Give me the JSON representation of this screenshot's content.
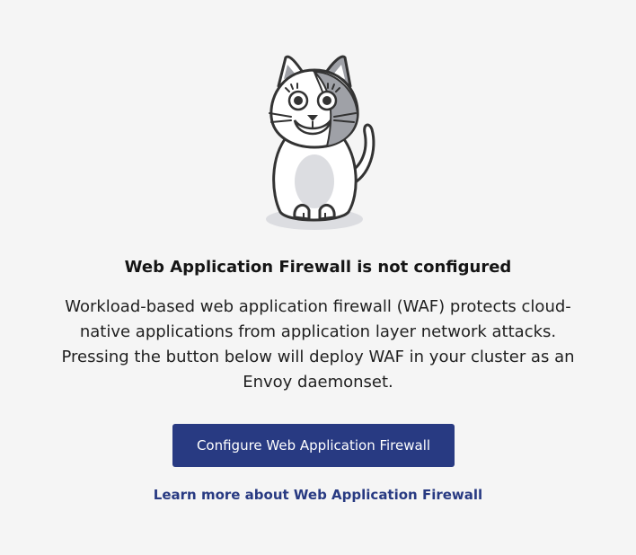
{
  "empty_state": {
    "title": "Web Application Firewall is not configured",
    "description": "Workload-based web application firewall (WAF) protects cloud-native applications from application layer network attacks. Pressing the button below will deploy WAF in your cluster as an Envoy daemonset.",
    "primary_button_label": "Configure Web Application Firewall",
    "learn_more_label": "Learn more about Web Application Firewall",
    "illustration": "cat-mascot-illustration",
    "colors": {
      "background": "#f5f5f5",
      "button": "#283a82",
      "link": "#283a82"
    }
  }
}
